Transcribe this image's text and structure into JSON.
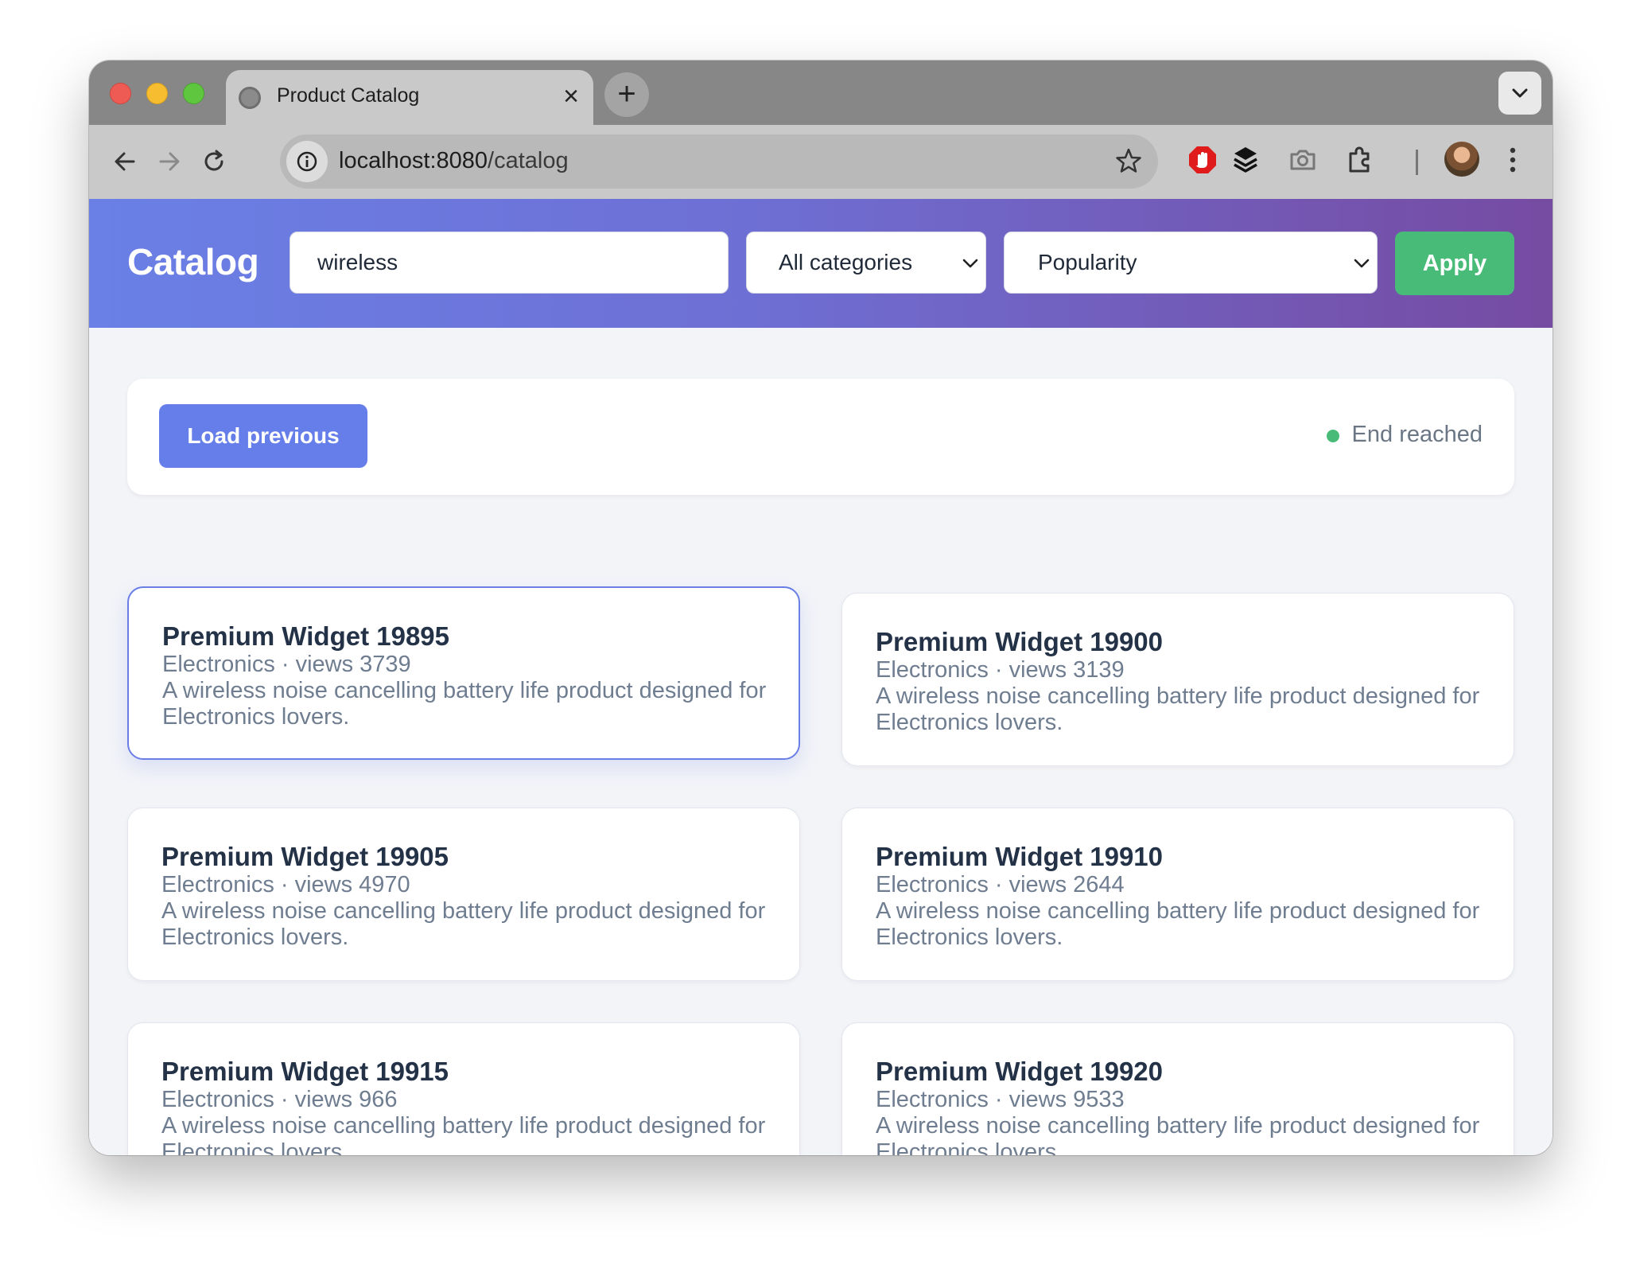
{
  "browser": {
    "tab_title": "Product Catalog",
    "tab_close": "×",
    "new_tab": "+",
    "url_host": "localhost:8080",
    "url_path": "/catalog"
  },
  "header": {
    "brand": "Catalog",
    "search_value": "wireless",
    "category_value": "All categories",
    "sort_value": "Popularity",
    "apply_label": "Apply"
  },
  "status": {
    "load_previous_label": "Load previous",
    "end_label": "End reached"
  },
  "products": [
    {
      "title": "Premium Widget 19895",
      "meta": "Electronics · views 3739",
      "desc": "A wireless noise cancelling battery life product designed for Electronics lovers."
    },
    {
      "title": "Premium Widget 19900",
      "meta": "Electronics · views 3139",
      "desc": "A wireless noise cancelling battery life product designed for Electronics lovers."
    },
    {
      "title": "Premium Widget 19905",
      "meta": "Electronics · views 4970",
      "desc": "A wireless noise cancelling battery life product designed for Electronics lovers."
    },
    {
      "title": "Premium Widget 19910",
      "meta": "Electronics · views 2644",
      "desc": "A wireless noise cancelling battery life product designed for Electronics lovers."
    },
    {
      "title": "Premium Widget 19915",
      "meta": "Electronics · views 966",
      "desc": "A wireless noise cancelling battery life product designed for Electronics lovers."
    },
    {
      "title": "Premium Widget 19920",
      "meta": "Electronics · views 9533",
      "desc": "A wireless noise cancelling battery life product designed for Electronics lovers."
    }
  ],
  "colors": {
    "hero_start": "#667eea",
    "hero_end": "#764ba2",
    "accent": "#667eea",
    "success": "#48bb78"
  },
  "icons": [
    "back-arrow-icon",
    "forward-arrow-icon",
    "reload-icon",
    "info-icon",
    "star-icon",
    "adblock-icon",
    "layers-icon",
    "camera-icon",
    "extensions-icon",
    "menu-dots-icon"
  ]
}
